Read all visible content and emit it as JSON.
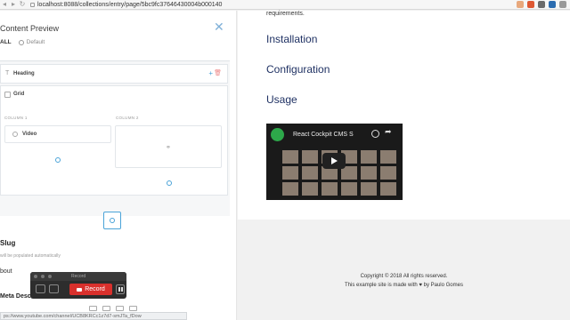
{
  "browser": {
    "url": "localhost:8088/collections/entry/page/5bc9fc37646430004b000140",
    "back_glyph": "◂",
    "forward_glyph": "▸",
    "reload_glyph": "↻",
    "extensions": [
      "#e8a87c",
      "#de5833",
      "#6a6a6a",
      "#2b6cb0",
      "#999999"
    ]
  },
  "editor": {
    "title": "Content Preview",
    "close_glyph": "✕",
    "tabs": {
      "all": "ALL",
      "default": "Default"
    },
    "heading_block": {
      "label": "Heading",
      "icon_glyph": "T",
      "plus_glyph": "+",
      "trash_glyph": "🗑"
    },
    "grid_block": {
      "label": "Grid",
      "columns": [
        "COLUMN 1",
        "COLUMN 2"
      ],
      "video_label": "Video",
      "empty_glyph": "⚭"
    },
    "fields": {
      "slug_label": "Slug",
      "slug_hint": "will be populated automatically",
      "about_label": "bout",
      "meta_label": "Meta Descr"
    }
  },
  "recorder": {
    "title": "Record",
    "record_label": "Record"
  },
  "status_url": "ps://www.youtube.com/channel/UCB8KRCc1z7d7-smJTa_fDow",
  "preview": {
    "intro": "requirements.",
    "headings": [
      "Installation",
      "Configuration",
      "Usage"
    ],
    "video": {
      "title": "React Cockpit CMS S",
      "share_glyph": "➦"
    },
    "footer": {
      "copyright": "Copyright © 2018 All rights reserved.",
      "credit": "This example site is made with ♥ by Paulo Gomes"
    }
  }
}
